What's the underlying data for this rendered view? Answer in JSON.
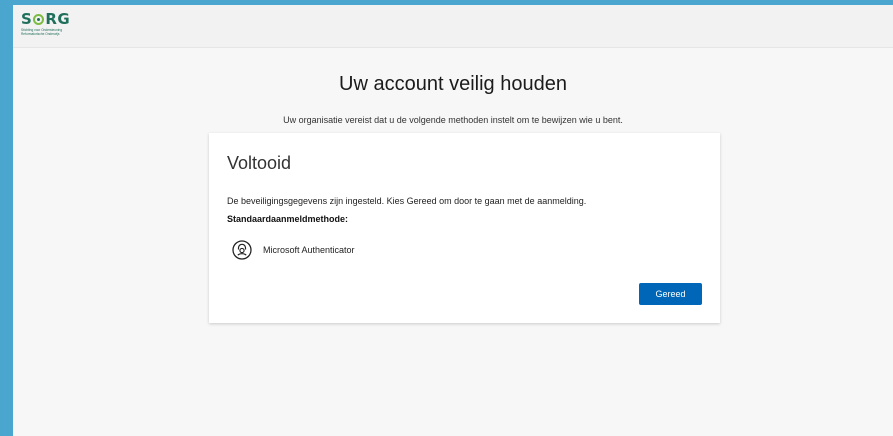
{
  "header": {
    "logo_text": "SORG",
    "logo_tagline": "Stichting voor Ondersteuning Reformatorische Onderwijs"
  },
  "page": {
    "title": "Uw account veilig houden",
    "subtitle": "Uw organisatie vereist dat u de volgende methoden instelt om te bewijzen wie u bent."
  },
  "card": {
    "title": "Voltooid",
    "message": "De beveiligingsgegevens zijn ingesteld. Kies Gereed om door te gaan met de aanmelding.",
    "default_method_label": "Standaardaanmeldmethode:",
    "method": {
      "icon": "authenticator-lock-icon",
      "label": "Microsoft Authenticator"
    },
    "done_button": "Gereed"
  },
  "colors": {
    "accent_blue": "#0067b8",
    "frame_border": "#4aa5cf",
    "logo_green": "#1f6f5a",
    "logo_lime": "#7dbb42"
  }
}
